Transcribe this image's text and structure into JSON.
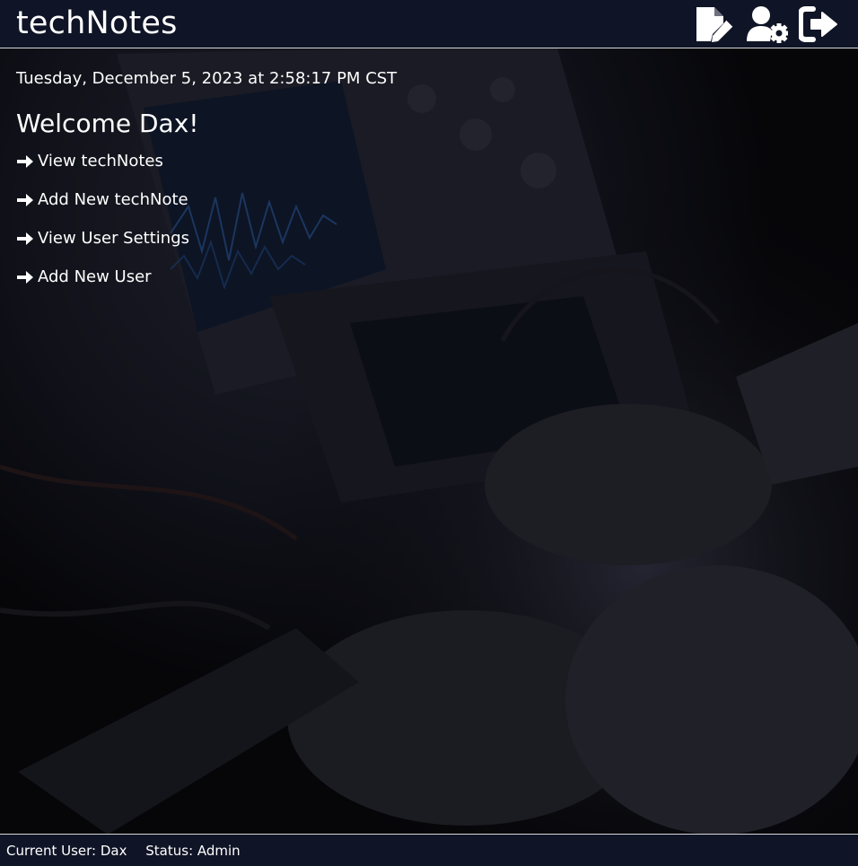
{
  "header": {
    "title": "techNotes",
    "icons": [
      {
        "name": "new-note-icon",
        "label": "Add New techNote"
      },
      {
        "name": "user-settings-icon",
        "label": "View User Settings"
      },
      {
        "name": "logout-icon",
        "label": "Logout"
      }
    ]
  },
  "main": {
    "datetime": "Tuesday, December 5, 2023 at 2:58:17 PM CST",
    "welcome": "Welcome Dax!",
    "links": [
      {
        "label": "View techNotes",
        "icon": "arrow-right-icon"
      },
      {
        "label": "Add New techNote",
        "icon": "arrow-right-icon"
      },
      {
        "label": "View User Settings",
        "icon": "arrow-right-icon"
      },
      {
        "label": "Add New User",
        "icon": "arrow-right-icon"
      }
    ]
  },
  "footer": {
    "current_user": "Current User: Dax",
    "status": "Status: Admin"
  },
  "colors": {
    "bar_background": "#0f1426",
    "text": "#ffffff",
    "page_background": "#050507"
  }
}
